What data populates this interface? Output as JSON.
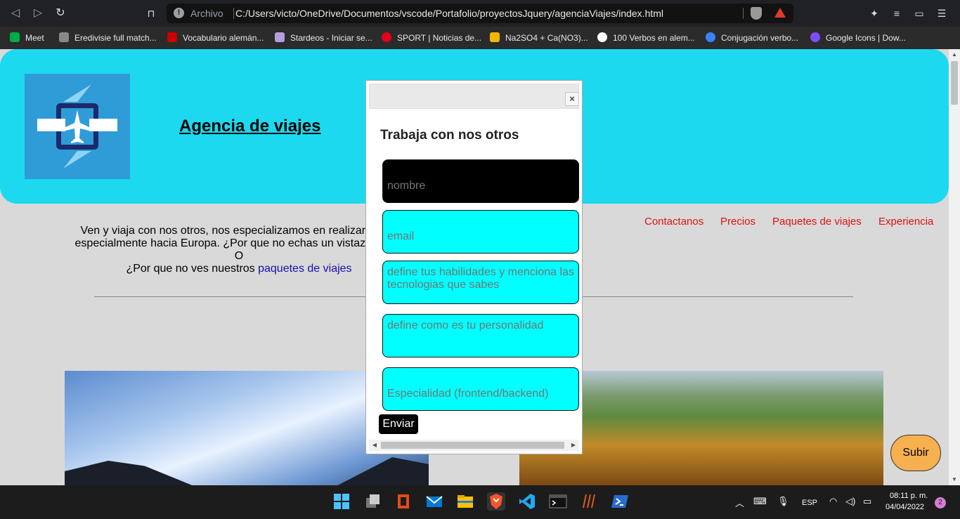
{
  "browser": {
    "address_label": "Archivo",
    "url": "C:/Users/victo/OneDrive/Documentos/vscode/Portafolio/proyectosJquery/agenciaViajes/index.html",
    "bookmarks": [
      {
        "label": "Meet",
        "color": "#00ac47"
      },
      {
        "label": "Eredivisie full match...",
        "color": "#888888"
      },
      {
        "label": "Vocabulario alemán...",
        "color": "#cc0000"
      },
      {
        "label": "Stardeos - Iniciar se...",
        "color": "#b39ddb"
      },
      {
        "label": "SPORT | Noticias de...",
        "color": "#e2001a"
      },
      {
        "label": "Na2SO4 + Ca(NO3)...",
        "color": "#f4b400"
      },
      {
        "label": "100 Verbos en alem...",
        "color": "#ffffff"
      },
      {
        "label": "Conjugación verbo...",
        "color": "#3b82f6"
      },
      {
        "label": "Google Icons | Dow...",
        "color": "#7c4dff"
      }
    ]
  },
  "site": {
    "title": "Agencia de viajes",
    "intro_line1": "Ven y viaja con nos otros, nos especializamos en realizar viajes",
    "intro_line2": "especialmente hacia Europa. ¿Por que no echas un vistazo a nue",
    "intro_line3": "O",
    "intro_line4_text": "¿Por que no ves nuestros ",
    "intro_line4_link": "paquetes de viajes",
    "nav": [
      "Contactanos",
      "Precios",
      "Paquetes de viajes",
      "Experiencia"
    ],
    "subir": "Subir"
  },
  "dialog": {
    "heading": "Trabaja con nos otros",
    "close": "×",
    "fields": [
      {
        "placeholder": "nombre"
      },
      {
        "placeholder": "email"
      },
      {
        "placeholder": "define tus habilidades y menciona las tecnologias que sabes"
      },
      {
        "placeholder": "define como es tu personalidad"
      },
      {
        "placeholder": "Especialidad (frontend/backend)"
      }
    ],
    "submit": "Enviar"
  },
  "taskbar": {
    "language": "ESP",
    "time": "08:11 p. m.",
    "date": "04/04/2022",
    "notifications": "2",
    "apps": [
      {
        "name": "windows-start",
        "color": "#4cc2ff"
      },
      {
        "name": "task-view",
        "color": "#9a9a9a"
      },
      {
        "name": "office",
        "color": "#e64a19"
      },
      {
        "name": "mail",
        "color": "#0078d4"
      },
      {
        "name": "file-explorer",
        "color": "#f8c200"
      },
      {
        "name": "brave",
        "color": "#fb542b"
      },
      {
        "name": "vscode",
        "color": "#23a9f2"
      },
      {
        "name": "terminal",
        "color": "#3a3a3a"
      },
      {
        "name": "winrar-app",
        "color": "#e05a1a"
      },
      {
        "name": "powershell",
        "color": "#2a6bd0"
      }
    ]
  }
}
